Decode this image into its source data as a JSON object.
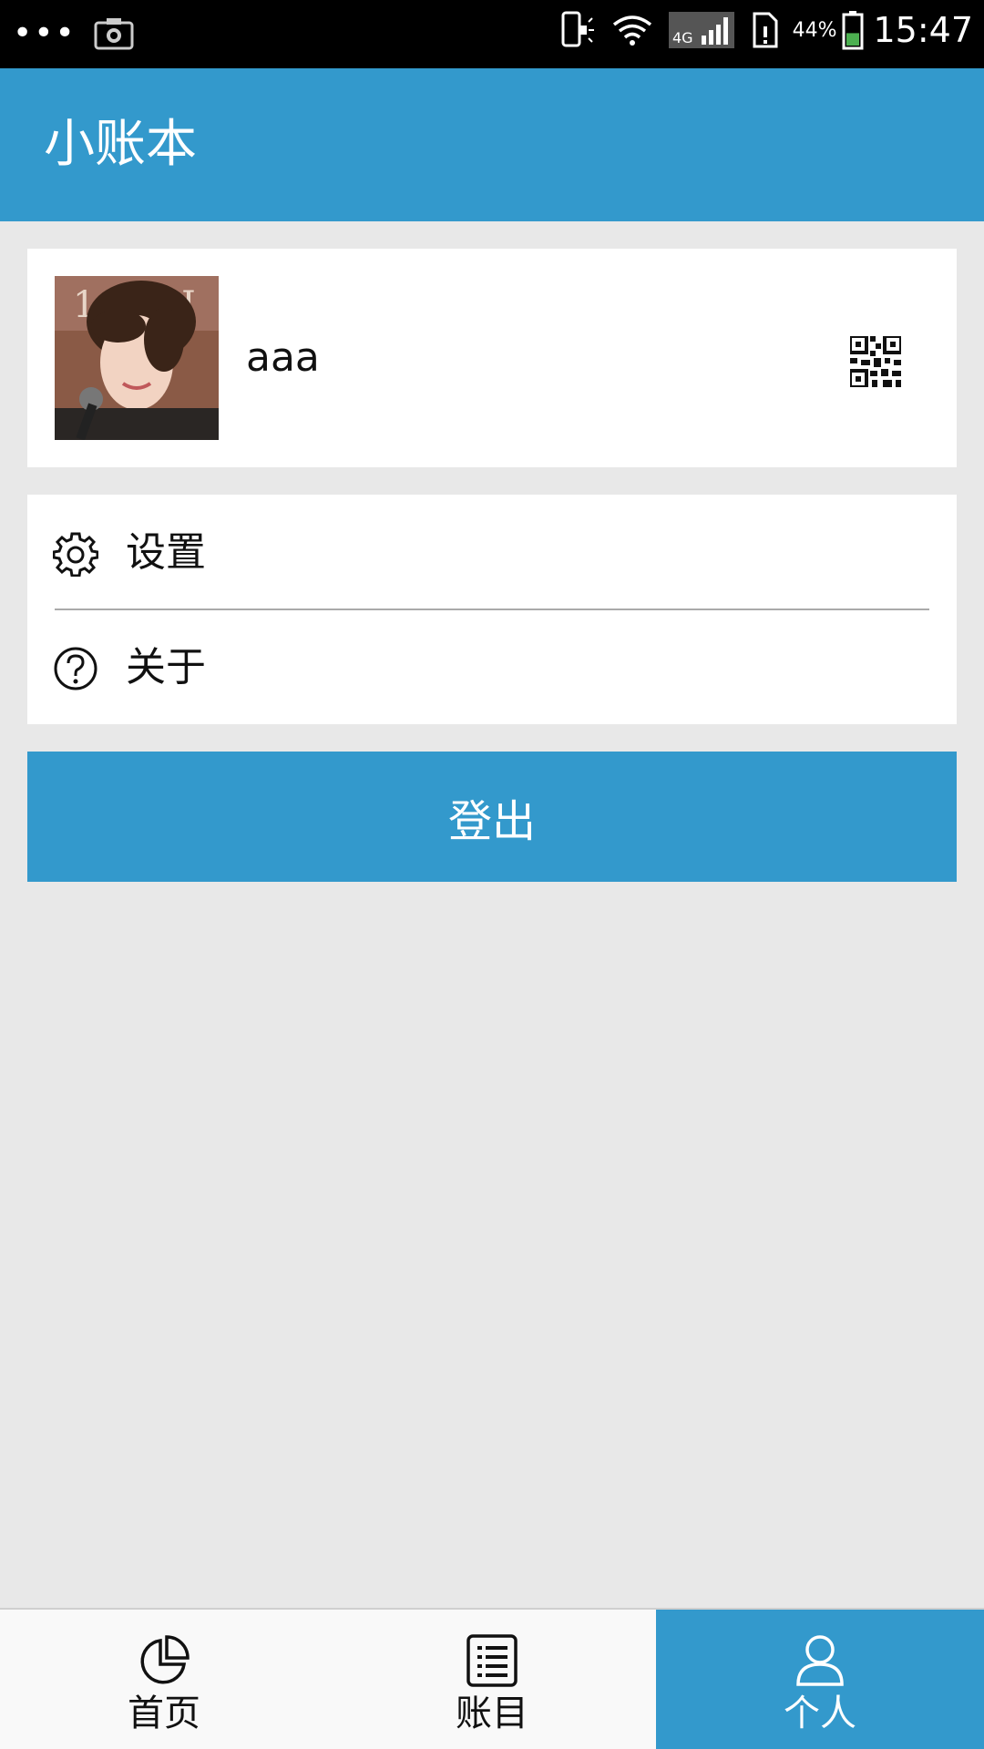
{
  "status_bar": {
    "dots": "•••",
    "network_type": "4G",
    "battery_percent": "44%",
    "battery_level": 0.44,
    "time": "15:47",
    "icons": [
      "camera-icon",
      "phone-vibrate-icon",
      "wifi-icon",
      "signal-icon",
      "sim-alert-icon",
      "battery-icon"
    ],
    "battery_color": "#4caf50"
  },
  "app_bar": {
    "title": "小账本",
    "color": "#3399cc"
  },
  "profile": {
    "username": "aaa",
    "avatar_icon": "avatar",
    "qr_icon": "qr-code-icon"
  },
  "menu": {
    "items": [
      {
        "label": "设置",
        "icon": "gear-icon"
      },
      {
        "label": "关于",
        "icon": "help-circle-icon"
      }
    ]
  },
  "logout": {
    "label": "登出"
  },
  "bottom_nav": {
    "items": [
      {
        "label": "首页",
        "icon": "pie-chart-icon",
        "active": false
      },
      {
        "label": "账目",
        "icon": "list-icon",
        "active": false
      },
      {
        "label": "个人",
        "icon": "person-icon",
        "active": true
      }
    ],
    "active_color": "#3399cc"
  }
}
